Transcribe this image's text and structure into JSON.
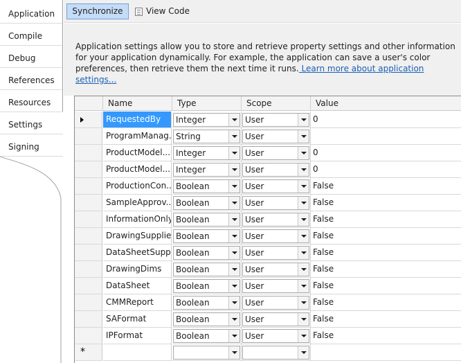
{
  "tabs": [
    {
      "label": "Application"
    },
    {
      "label": "Compile"
    },
    {
      "label": "Debug"
    },
    {
      "label": "References"
    },
    {
      "label": "Resources"
    },
    {
      "label": "Settings",
      "active": true
    },
    {
      "label": "Signing"
    }
  ],
  "toolbar": {
    "synchronize_label": "Synchronize",
    "view_code_label": "View Code"
  },
  "description": {
    "text": "Application settings allow you to store and retrieve property settings and other information for your application dynamically. For example, the application can save a user's color preferences, then retrieve them the next time it runs.",
    "link_text": " Learn more about application settings..."
  },
  "grid": {
    "columns": [
      "Name",
      "Type",
      "Scope",
      "Value"
    ],
    "rows": [
      {
        "name": "RequestedBy",
        "type": "Integer",
        "scope": "User",
        "value": "0"
      },
      {
        "name": "ProgramManag...",
        "type": "String",
        "scope": "User",
        "value": ""
      },
      {
        "name": "ProductModel...",
        "type": "Integer",
        "scope": "User",
        "value": "0"
      },
      {
        "name": "ProductModel...",
        "type": "Integer",
        "scope": "User",
        "value": "0"
      },
      {
        "name": "ProductionCon...",
        "type": "Boolean",
        "scope": "User",
        "value": "False"
      },
      {
        "name": "SampleApprov...",
        "type": "Boolean",
        "scope": "User",
        "value": "False"
      },
      {
        "name": "InformationOnly",
        "type": "Boolean",
        "scope": "User",
        "value": "False"
      },
      {
        "name": "DrawingSupplied",
        "type": "Boolean",
        "scope": "User",
        "value": "False"
      },
      {
        "name": "DataSheetSuppl...",
        "type": "Boolean",
        "scope": "User",
        "value": "False"
      },
      {
        "name": "DrawingDims",
        "type": "Boolean",
        "scope": "User",
        "value": "False"
      },
      {
        "name": "DataSheet",
        "type": "Boolean",
        "scope": "User",
        "value": "False"
      },
      {
        "name": "CMMReport",
        "type": "Boolean",
        "scope": "User",
        "value": "False"
      },
      {
        "name": "SAFormat",
        "type": "Boolean",
        "scope": "User",
        "value": "False"
      },
      {
        "name": "IPFormat",
        "type": "Boolean",
        "scope": "User",
        "value": "False"
      }
    ],
    "current_row_icon": "current-row-arrow-icon",
    "new_row_icon": "new-row-star-icon",
    "new_row_symbol": "*"
  },
  "colors": {
    "selected_cell": "#3399ff",
    "toolbar_bg": "#f0f0f0",
    "sync_button_bg": "#c5dcf7",
    "link": "#1a5fb4"
  }
}
